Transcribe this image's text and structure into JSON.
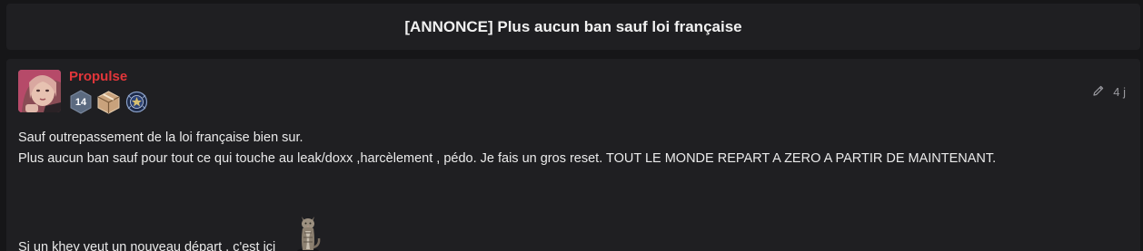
{
  "topic": {
    "title": "[ANNONCE] Plus aucun ban sauf loi française"
  },
  "post": {
    "author": "Propulse",
    "level": "14",
    "time_ago": "4 j",
    "lines": [
      "Sauf outrepassement de la loi française bien sur.",
      "Plus aucun ban sauf pour tout ce qui touche au leak/doxx ,harcèlement , pédo. Je fais un gros reset. TOUT LE MONDE REPART A ZERO A PARTIR DE MAINTENANT.",
      "Si un khey veut un nouveau départ , c'est ici"
    ],
    "icons": {
      "edit": "pencil-icon",
      "badge_2": "box-icon",
      "badge_3": "emblem-icon",
      "sticker": "cat-sticker"
    }
  },
  "colors": {
    "background": "#161618",
    "card": "#1f1f22",
    "username": "#e2363a",
    "level_badge": "#5b6a80",
    "meta_text": "#9a9aa0"
  }
}
